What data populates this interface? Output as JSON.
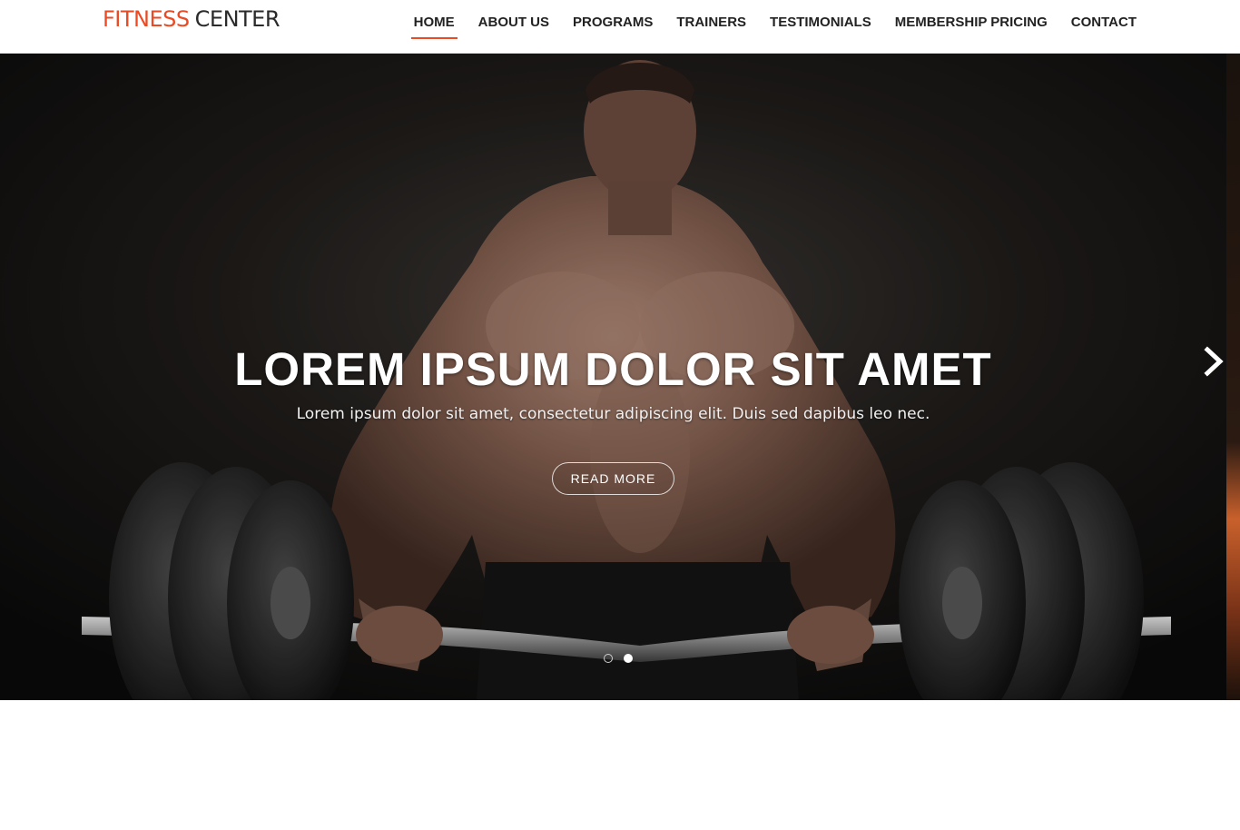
{
  "brand": {
    "name_part1": "FITNESS",
    "name_part2": "CENTER",
    "accent_color": "#ea4a24",
    "dark_color": "#2b2b2b"
  },
  "nav": {
    "items": [
      {
        "label": "HOME",
        "active": true
      },
      {
        "label": "ABOUT US",
        "active": false
      },
      {
        "label": "PROGRAMS",
        "active": false
      },
      {
        "label": "TRAINERS",
        "active": false
      },
      {
        "label": "TESTIMONIALS",
        "active": false
      },
      {
        "label": "MEMBERSHIP PRICING",
        "active": false
      },
      {
        "label": "CONTACT",
        "active": false
      }
    ]
  },
  "hero": {
    "title": "LOREM IPSUM DOLOR SIT AMET",
    "subtitle": "Lorem ipsum dolor sit amet, consectetur adipiscing elit. Duis sed dapibus leo nec.",
    "cta_label": "READ MORE",
    "image_subject": "athlete-lifting-barbell",
    "next_icon": "chevron-right-icon",
    "slides_total": 2,
    "active_slide": 2
  }
}
